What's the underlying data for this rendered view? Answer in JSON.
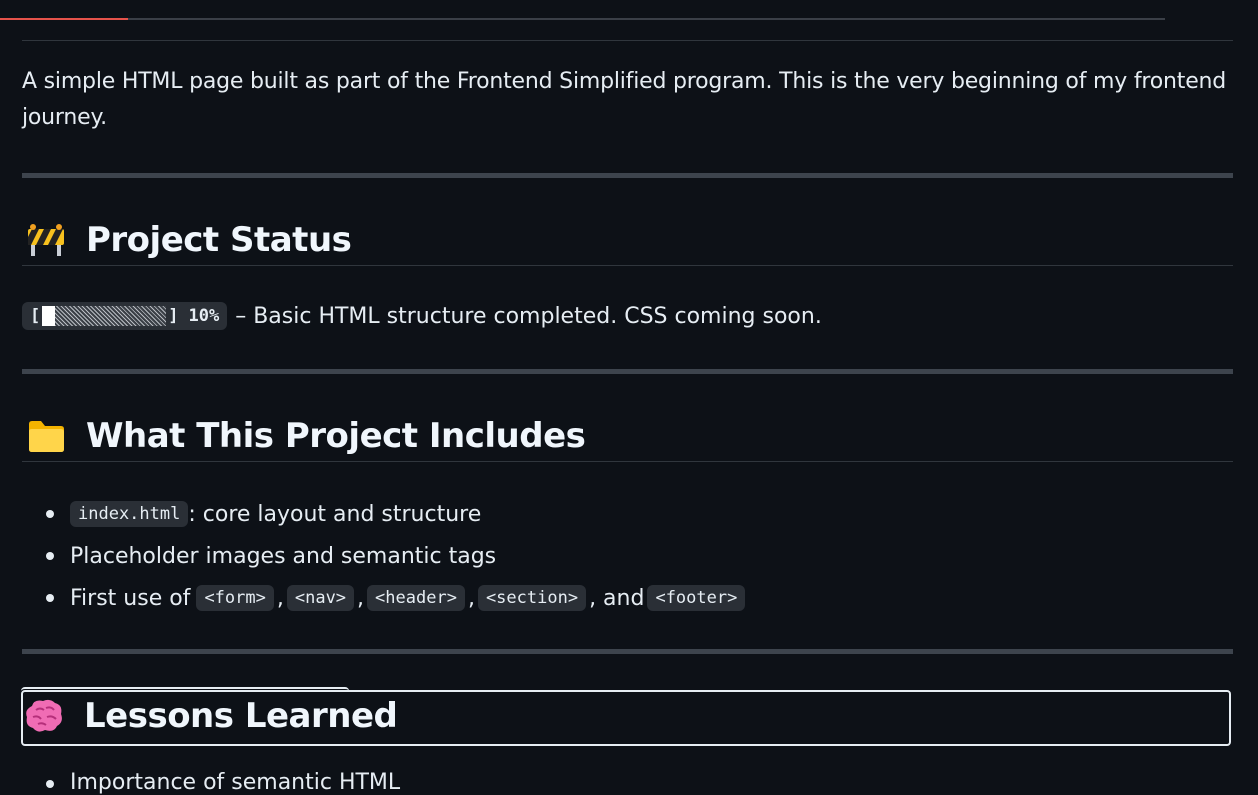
{
  "reading_progress": {
    "percent": 11,
    "color": "#e5534b"
  },
  "intro": {
    "text": "A simple HTML page built as part of the Frontend Simplified program. This is the very beginning of my frontend journey."
  },
  "sections": {
    "status": {
      "icon": "construction-barrier-icon",
      "title": "Project Status",
      "progress_bracket_open": "[",
      "progress_bracket_close": "]",
      "progress_percent_label": "10%",
      "progress_value": 10,
      "status_text": "– Basic HTML structure completed. CSS coming soon."
    },
    "includes": {
      "icon": "folder-icon",
      "title": "What This Project Includes",
      "items": [
        {
          "code": "index.html",
          "text": ": core layout and structure"
        },
        {
          "text": "Placeholder images and semantic tags"
        },
        {
          "prefix": "First use of",
          "tags": [
            "<form>",
            "<nav>",
            "<header>",
            "<section>",
            "<footer>"
          ],
          "sep": ",",
          "and": ", and"
        }
      ]
    },
    "lessons": {
      "icon": "brain-icon",
      "title": "Lessons Learned",
      "first_item_partial": "Importance of semantic HTML"
    }
  },
  "colors": {
    "background": "#0d1117",
    "text": "#e6edf3",
    "rule": "#3d444d",
    "code_bg": "#2a2f36"
  }
}
